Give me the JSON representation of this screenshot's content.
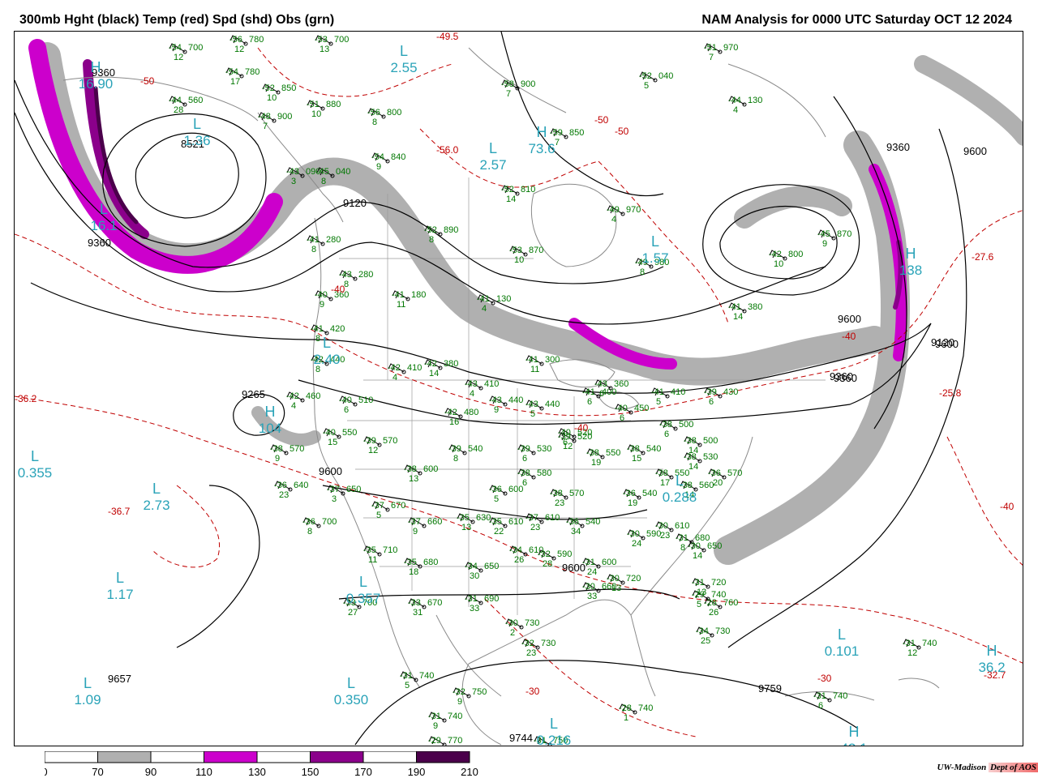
{
  "header": {
    "left_title": "300mb Hght (black) Temp (red) Spd (shd) Obs (grn)",
    "right_title": "NAM Analysis for 0000 UTC Saturday  OCT 12 2024"
  },
  "credit": {
    "org": "UW-Madison",
    "dept": "Dept of AOS"
  },
  "colors": {
    "height": "#000000",
    "temp": "#c00000",
    "obs": "#007700",
    "center_label": "#2aa3b8",
    "land": "#8a8a8a",
    "band_70": "#b0b0b0",
    "band_110": "#cc00cc",
    "band_150": "#8b008b",
    "band_190": "#4b004b"
  },
  "legend": {
    "ticks": [
      "0",
      "70",
      "90",
      "110",
      "130",
      "150",
      "170",
      "190",
      "210"
    ],
    "bins": [
      {
        "color": "#ffffff"
      },
      {
        "color": "#b0b0b0"
      },
      {
        "color": "#ffffff"
      },
      {
        "color": "#cc00cc"
      },
      {
        "color": "#ffffff"
      },
      {
        "color": "#8b008b"
      },
      {
        "color": "#ffffff"
      },
      {
        "color": "#4b004b"
      }
    ]
  },
  "height_labels": [
    "9360",
    "8521",
    "9120",
    "9360",
    "9265",
    "9600",
    "9600",
    "9657",
    "9360",
    "9600",
    "9360",
    "9120",
    "9600",
    "9360",
    "9600",
    "9759",
    "9744"
  ],
  "temp_labels": [
    "-49.5",
    "-50",
    "-56.0",
    "-50",
    "-50",
    "-40",
    "-36.2",
    "-36.7",
    "-40",
    "-40",
    "-27.6",
    "-25.8",
    "-30",
    "-32.7",
    "-30",
    "-40"
  ],
  "centers": [
    {
      "type": "L",
      "value": "2.55"
    },
    {
      "type": "L",
      "value": "1.36"
    },
    {
      "type": "H",
      "value": "16.90"
    },
    {
      "type": "L",
      "value": "16.1"
    },
    {
      "type": "L",
      "value": "2.57"
    },
    {
      "type": "H",
      "value": "73.6"
    },
    {
      "type": "L",
      "value": "1.57"
    },
    {
      "type": "L",
      "value": "2.40"
    },
    {
      "type": "H",
      "value": "104"
    },
    {
      "type": "L",
      "value": "0.355"
    },
    {
      "type": "L",
      "value": "2.73"
    },
    {
      "type": "L",
      "value": "1.17"
    },
    {
      "type": "L",
      "value": "0.357"
    },
    {
      "type": "L",
      "value": "1.09"
    },
    {
      "type": "L",
      "value": "0.350"
    },
    {
      "type": "L",
      "value": "0.216"
    },
    {
      "type": "L",
      "value": "0.101"
    },
    {
      "type": "H",
      "value": "36.2"
    },
    {
      "type": "H",
      "value": "42.1"
    },
    {
      "type": "L",
      "value": "0.288"
    },
    {
      "type": "H",
      "value": "138"
    }
  ],
  "stations": [
    {
      "t": "-54",
      "h": "700",
      "d": "12"
    },
    {
      "t": "-56",
      "h": "780",
      "d": "12"
    },
    {
      "t": "-53",
      "h": "700",
      "d": "13"
    },
    {
      "t": "-54",
      "h": "780",
      "d": "17"
    },
    {
      "t": "-52",
      "h": "850",
      "d": "10"
    },
    {
      "t": "-44",
      "h": "560",
      "d": "28"
    },
    {
      "t": "-51",
      "h": "880",
      "d": "10"
    },
    {
      "t": "-56",
      "h": "800",
      "d": "8"
    },
    {
      "t": "-48",
      "h": "900",
      "d": "7"
    },
    {
      "t": "-54",
      "h": "840",
      "d": "9"
    },
    {
      "t": "-51",
      "h": "970",
      "d": "7"
    },
    {
      "t": "-52",
      "h": "040",
      "d": "5"
    },
    {
      "t": "-44",
      "h": "130",
      "d": "4"
    },
    {
      "t": "-58",
      "h": "900",
      "d": "7"
    },
    {
      "t": "-59",
      "h": "850",
      "d": "7"
    },
    {
      "t": "-52",
      "h": "810",
      "d": "14"
    },
    {
      "t": "-49",
      "h": "970",
      "d": "4"
    },
    {
      "t": "-53",
      "h": "870",
      "d": "10"
    },
    {
      "t": "-49",
      "h": "980",
      "d": "8"
    },
    {
      "t": "-42",
      "h": "800",
      "d": "10"
    },
    {
      "t": "-45",
      "h": "870",
      "d": "9"
    },
    {
      "t": "-43",
      "h": "090",
      "d": "3"
    },
    {
      "t": "-45",
      "h": "040",
      "d": "8"
    },
    {
      "t": "-52",
      "h": "890",
      "d": "8"
    },
    {
      "t": "-41",
      "h": "280",
      "d": "8"
    },
    {
      "t": "-43",
      "h": "280",
      "d": "8"
    },
    {
      "t": "-40",
      "h": "360",
      "d": "9"
    },
    {
      "t": "-41",
      "h": "180",
      "d": "11"
    },
    {
      "t": "-41",
      "h": "130",
      "d": "4"
    },
    {
      "t": "-41",
      "h": "420",
      "d": "8"
    },
    {
      "t": "-42",
      "h": "440",
      "d": "8"
    },
    {
      "t": "-42",
      "h": "410",
      "d": "4"
    },
    {
      "t": "-42",
      "h": "380",
      "d": "14"
    },
    {
      "t": "-41",
      "h": "300",
      "d": "11"
    },
    {
      "t": "-42",
      "h": "460",
      "d": "4"
    },
    {
      "t": "-40",
      "h": "510",
      "d": "6"
    },
    {
      "t": "-43",
      "h": "410",
      "d": "4"
    },
    {
      "t": "-43",
      "h": "440",
      "d": "9"
    },
    {
      "t": "-43",
      "h": "440",
      "d": "5"
    },
    {
      "t": "-41",
      "h": "400",
      "d": "6"
    },
    {
      "t": "-43",
      "h": "360",
      "d": "6"
    },
    {
      "t": "-41",
      "h": "410",
      "d": "5"
    },
    {
      "t": "-40",
      "h": "450",
      "d": "6"
    },
    {
      "t": "-39",
      "h": "430",
      "d": "6"
    },
    {
      "t": "-41",
      "h": "380",
      "d": "14"
    },
    {
      "t": "-40",
      "h": "520",
      "d": "6"
    },
    {
      "t": "-42",
      "h": "480",
      "d": "16"
    },
    {
      "t": "-40",
      "h": "550",
      "d": "15"
    },
    {
      "t": "-39",
      "h": "570",
      "d": "12"
    },
    {
      "t": "-39",
      "h": "540",
      "d": "8"
    },
    {
      "t": "-39",
      "h": "530",
      "d": "6"
    },
    {
      "t": "-39",
      "h": "520",
      "d": "12"
    },
    {
      "t": "-38",
      "h": "550",
      "d": "19"
    },
    {
      "t": "-38",
      "h": "540",
      "d": "15"
    },
    {
      "t": "-38",
      "h": "500",
      "d": "6"
    },
    {
      "t": "-38",
      "h": "500",
      "d": "14"
    },
    {
      "t": "-38",
      "h": "530",
      "d": "14"
    },
    {
      "t": "-38",
      "h": "570",
      "d": "9"
    },
    {
      "t": "-38",
      "h": "600",
      "d": "13"
    },
    {
      "t": "-38",
      "h": "580",
      "d": "6"
    },
    {
      "t": "-38",
      "h": "570",
      "d": "23"
    },
    {
      "t": "-38",
      "h": "550",
      "d": "17"
    },
    {
      "t": "-38",
      "h": "560",
      "d": "14"
    },
    {
      "t": "-36",
      "h": "570",
      "d": "20"
    },
    {
      "t": "-36",
      "h": "640",
      "d": "23"
    },
    {
      "t": "-37",
      "h": "650",
      "d": "3"
    },
    {
      "t": "-36",
      "h": "600",
      "d": "5"
    },
    {
      "t": "-37",
      "h": "670",
      "d": "5"
    },
    {
      "t": "-37",
      "h": "660",
      "d": "9"
    },
    {
      "t": "-35",
      "h": "630",
      "d": "13"
    },
    {
      "t": "-35",
      "h": "610",
      "d": "22"
    },
    {
      "t": "-37",
      "h": "610",
      "d": "23"
    },
    {
      "t": "-36",
      "h": "540",
      "d": "34"
    },
    {
      "t": "-36",
      "h": "540",
      "d": "19"
    },
    {
      "t": "-36",
      "h": "700",
      "d": "8"
    },
    {
      "t": "-35",
      "h": "710",
      "d": "11"
    },
    {
      "t": "-35",
      "h": "680",
      "d": "18"
    },
    {
      "t": "-34",
      "h": "650",
      "d": "30"
    },
    {
      "t": "-34",
      "h": "610",
      "d": "26"
    },
    {
      "t": "-32",
      "h": "590",
      "d": "28"
    },
    {
      "t": "-31",
      "h": "600",
      "d": "24"
    },
    {
      "t": "-30",
      "h": "590",
      "d": "24"
    },
    {
      "t": "-30",
      "h": "610",
      "d": "23"
    },
    {
      "t": "-31",
      "h": "680",
      "d": "8"
    },
    {
      "t": "-30",
      "h": "650",
      "d": "14"
    },
    {
      "t": "-30",
      "h": "660",
      "d": "33"
    },
    {
      "t": "-30",
      "h": "720",
      "d": "13"
    },
    {
      "t": "-31",
      "h": "720",
      "d": "13"
    },
    {
      "t": "-29",
      "h": "740",
      "d": "5"
    },
    {
      "t": "-28",
      "h": "760",
      "d": "26"
    },
    {
      "t": "-34",
      "h": "730",
      "d": "25"
    },
    {
      "t": "-33",
      "h": "700",
      "d": "27"
    },
    {
      "t": "-33",
      "h": "670",
      "d": "31"
    },
    {
      "t": "-31",
      "h": "690",
      "d": "33"
    },
    {
      "t": "-30",
      "h": "730",
      "d": "2"
    },
    {
      "t": "-32",
      "h": "730",
      "d": "23"
    },
    {
      "t": "-31",
      "h": "740",
      "d": "5"
    },
    {
      "t": "-32",
      "h": "750",
      "d": "9"
    },
    {
      "t": "-31",
      "h": "740",
      "d": "9"
    },
    {
      "t": "-29",
      "h": "770",
      "d": "16"
    },
    {
      "t": "-28",
      "h": "740",
      "d": "1"
    },
    {
      "t": "-31",
      "h": "750",
      "d": "3"
    },
    {
      "t": "-31",
      "h": "740",
      "d": "6"
    },
    {
      "t": "-31",
      "h": "740",
      "d": "12"
    }
  ]
}
